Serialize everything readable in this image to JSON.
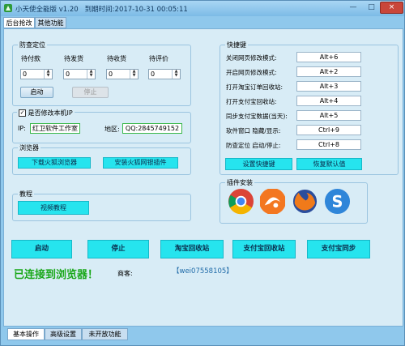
{
  "window": {
    "title": "小天使全能版 v1.20",
    "expiry": "到期时间:2017-10-31 00:05:11",
    "min_glyph": "—",
    "max_glyph": "□",
    "close_glyph": "×"
  },
  "top_tabs": [
    "后台抢改",
    "其他功能"
  ],
  "anti_position": {
    "title": "防查定位",
    "columns": [
      "待付款",
      "待发货",
      "待收货",
      "待评价"
    ],
    "values": [
      "0",
      "0",
      "0",
      "0"
    ],
    "start_label": "启动",
    "stop_label": "停止"
  },
  "local_ip": {
    "checkbox_label": "是否修改本机IP",
    "ip_label": "IP:",
    "ip_value": "红卫软件工作室",
    "region_label": "地区:",
    "region_value": "QQ:2845749152"
  },
  "browser": {
    "title": "浏览器",
    "download_label": "下载火狐浏览器",
    "install_label": "安装火狐网银插件"
  },
  "tutorial": {
    "title": "教程",
    "video_label": "视频教程"
  },
  "hotkeys": {
    "title": "快捷键",
    "items": [
      {
        "label": "关闭网页修改模式:",
        "key": "Alt+6"
      },
      {
        "label": "开启网页修改模式:",
        "key": "Alt+2"
      },
      {
        "label": "打开淘宝订单回收站:",
        "key": "Alt+3"
      },
      {
        "label": "打开支付宝回收站:",
        "key": "Alt+4"
      },
      {
        "label": "同步支付宝数据(当天):",
        "key": "Alt+5"
      },
      {
        "label": "软件窗口 隐藏/显示:",
        "key": "Ctrl+9"
      },
      {
        "label": "防查定位 启动/停止:",
        "key": "Ctrl+8"
      }
    ],
    "set_label": "设置快捷键",
    "restore_label": "恢复默认值"
  },
  "plugins": {
    "title": "插件安装",
    "icons": [
      "chrome-icon",
      "uc-browser-icon",
      "firefox-icon",
      "sogou-icon"
    ]
  },
  "actions": [
    "启动",
    "停止",
    "淘宝回收站",
    "支付宝回收站",
    "支付宝同步"
  ],
  "status": {
    "connected": "已连接到浏览器！",
    "vendor_label": "商客:",
    "vendor_value": "【wei07558105】"
  },
  "bottom_tabs": [
    "基本操作",
    "高级设置",
    "未开放功能"
  ],
  "colors": {
    "accent_cyan": "#26e4ee",
    "status_green": "#1aa81a",
    "field_green_border": "#3ab84a"
  }
}
